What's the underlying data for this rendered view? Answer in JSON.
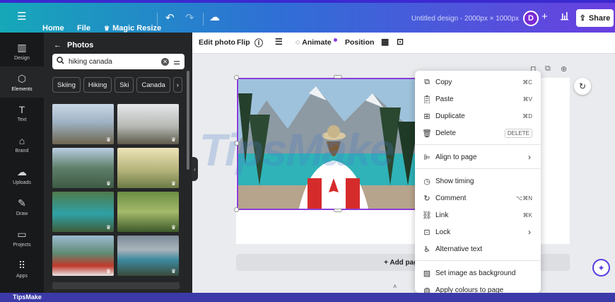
{
  "topbar": {
    "home": "Home",
    "file": "File",
    "magic_resize": "Magic Resize",
    "title": "Untitled design - 2000px × 1000px",
    "avatar_initial": "D",
    "share": "Share"
  },
  "rail": {
    "items": [
      {
        "label": "Design",
        "icon": "layout-icon"
      },
      {
        "label": "Elements",
        "icon": "shapes-icon"
      },
      {
        "label": "Text",
        "icon": "text-icon"
      },
      {
        "label": "Brand",
        "icon": "brand-icon"
      },
      {
        "label": "Uploads",
        "icon": "cloud-upload-icon"
      },
      {
        "label": "Draw",
        "icon": "pen-icon"
      },
      {
        "label": "Projects",
        "icon": "folder-icon"
      },
      {
        "label": "Apps",
        "icon": "grid-icon"
      }
    ]
  },
  "panel": {
    "title": "Photos",
    "search_value": "hiking canada",
    "chips": [
      "Skiing",
      "Hiking",
      "Ski",
      "Canada"
    ]
  },
  "toolbar": {
    "edit_photo": "Edit photo",
    "flip": "Flip",
    "animate": "Animate",
    "position": "Position"
  },
  "canvas": {
    "add_page": "+ Add page",
    "watermark": "TipsMake"
  },
  "context_menu": {
    "items": [
      {
        "label": "Copy",
        "shortcut": "⌘C"
      },
      {
        "label": "Paste",
        "shortcut": "⌘V"
      },
      {
        "label": "Duplicate",
        "shortcut": "⌘D"
      },
      {
        "label": "Delete",
        "shortcut": "DELETE"
      },
      {
        "label": "Align to page",
        "shortcut": ""
      },
      {
        "label": "Show timing",
        "shortcut": ""
      },
      {
        "label": "Comment",
        "shortcut": "⌥⌘N"
      },
      {
        "label": "Link",
        "shortcut": "⌘K"
      },
      {
        "label": "Lock",
        "shortcut": ""
      },
      {
        "label": "Alternative text",
        "shortcut": ""
      },
      {
        "label": "Set image as background",
        "shortcut": ""
      },
      {
        "label": "Apply colours to page",
        "shortcut": ""
      }
    ]
  },
  "footer": {
    "brand": "TipsMake"
  },
  "colors": {
    "accent": "#8b3fd9",
    "topbar_start": "#15a8b8",
    "topbar_end": "#6a3fe0",
    "rail_bg": "#18191b",
    "panel_bg": "#252627"
  }
}
